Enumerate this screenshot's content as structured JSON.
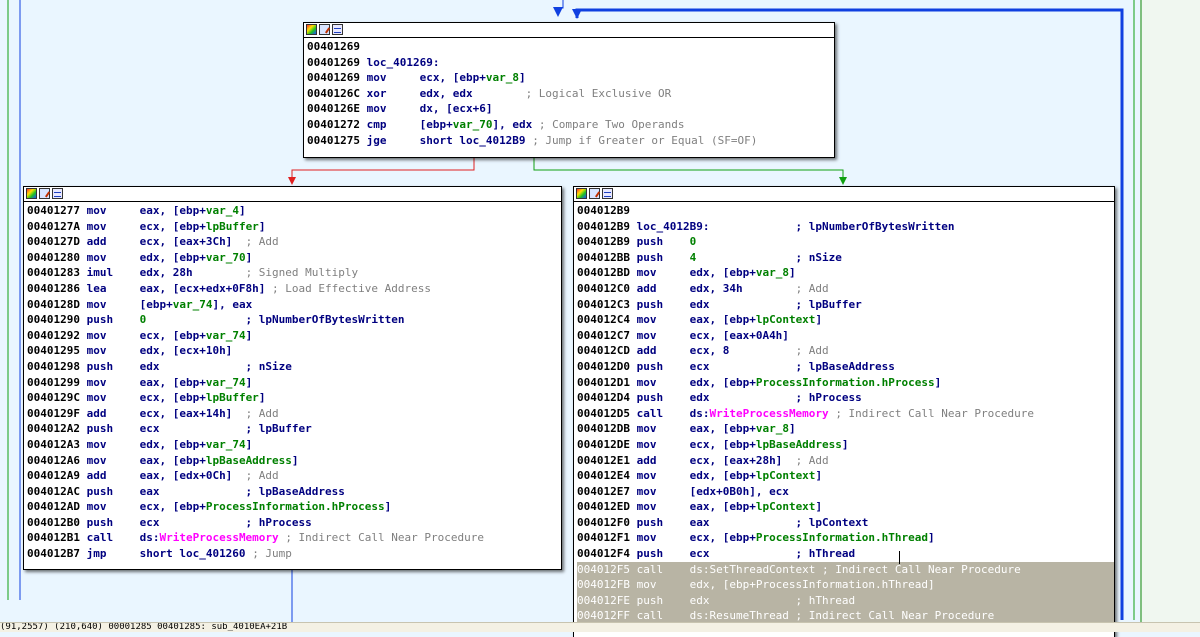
{
  "graph": {
    "nodes": [
      {
        "id": "top",
        "lines": [
          [
            [
              "00401269",
              "addr"
            ]
          ],
          [
            [
              "00401269 ",
              "addr"
            ],
            [
              "loc_401269:",
              "lbl"
            ]
          ],
          [
            [
              "00401269 ",
              "addr"
            ],
            [
              "mov     ",
              "mn"
            ],
            [
              "ecx, [ebp+",
              "op"
            ],
            [
              "var_8",
              "var"
            ],
            [
              "]",
              "op"
            ]
          ],
          [
            [
              "0040126C ",
              "addr"
            ],
            [
              "xor     ",
              "mn"
            ],
            [
              "edx, edx        ",
              "op"
            ],
            [
              "; Logical Exclusive OR",
              "cm"
            ]
          ],
          [
            [
              "0040126E ",
              "addr"
            ],
            [
              "mov     ",
              "mn"
            ],
            [
              "dx, [ecx+6]",
              "op"
            ]
          ],
          [
            [
              "00401272 ",
              "addr"
            ],
            [
              "cmp     ",
              "mn"
            ],
            [
              "[ebp+",
              "op"
            ],
            [
              "var_70",
              "var"
            ],
            [
              "], edx ",
              "op"
            ],
            [
              "; Compare Two Operands",
              "cm"
            ]
          ],
          [
            [
              "00401275 ",
              "addr"
            ],
            [
              "jge     ",
              "mn"
            ],
            [
              "short loc_4012B9 ",
              "op"
            ],
            [
              "; Jump if Greater or Equal (SF=OF)",
              "cm"
            ]
          ]
        ]
      },
      {
        "id": "left",
        "lines": [
          [
            [
              "00401277 ",
              "addr"
            ],
            [
              "mov     ",
              "mn"
            ],
            [
              "eax, [ebp+",
              "op"
            ],
            [
              "var_4",
              "var"
            ],
            [
              "]",
              "op"
            ]
          ],
          [
            [
              "0040127A ",
              "addr"
            ],
            [
              "mov     ",
              "mn"
            ],
            [
              "ecx, [ebp+",
              "op"
            ],
            [
              "lpBuffer",
              "var"
            ],
            [
              "]",
              "op"
            ]
          ],
          [
            [
              "0040127D ",
              "addr"
            ],
            [
              "add     ",
              "mn"
            ],
            [
              "ecx, [eax+3Ch]  ",
              "op"
            ],
            [
              "; Add",
              "cm"
            ]
          ],
          [
            [
              "00401280 ",
              "addr"
            ],
            [
              "mov     ",
              "mn"
            ],
            [
              "edx, [ebp+",
              "op"
            ],
            [
              "var_70",
              "var"
            ],
            [
              "]",
              "op"
            ]
          ],
          [
            [
              "00401283 ",
              "addr"
            ],
            [
              "imul    ",
              "mn"
            ],
            [
              "edx, 28h        ",
              "op"
            ],
            [
              "; Signed Multiply",
              "cm"
            ]
          ],
          [
            [
              "00401286 ",
              "addr"
            ],
            [
              "lea     ",
              "mn"
            ],
            [
              "eax, [ecx+edx+0F8h] ",
              "op"
            ],
            [
              "; Load Effective Address",
              "cm"
            ]
          ],
          [
            [
              "0040128D ",
              "addr"
            ],
            [
              "mov     ",
              "mn"
            ],
            [
              "[ebp+",
              "op"
            ],
            [
              "var_74",
              "var"
            ],
            [
              "], eax",
              "op"
            ]
          ],
          [
            [
              "00401290 ",
              "addr"
            ],
            [
              "push    ",
              "mn"
            ],
            [
              "0",
              "num"
            ],
            [
              "               ; lpNumberOfBytesWritten",
              "op"
            ]
          ],
          [
            [
              "00401292 ",
              "addr"
            ],
            [
              "mov     ",
              "mn"
            ],
            [
              "ecx, [ebp+",
              "op"
            ],
            [
              "var_74",
              "var"
            ],
            [
              "]",
              "op"
            ]
          ],
          [
            [
              "00401295 ",
              "addr"
            ],
            [
              "mov     ",
              "mn"
            ],
            [
              "edx, [ecx+10h]",
              "op"
            ]
          ],
          [
            [
              "00401298 ",
              "addr"
            ],
            [
              "push    ",
              "mn"
            ],
            [
              "edx             ; nSize",
              "op"
            ]
          ],
          [
            [
              "00401299 ",
              "addr"
            ],
            [
              "mov     ",
              "mn"
            ],
            [
              "eax, [ebp+",
              "op"
            ],
            [
              "var_74",
              "var"
            ],
            [
              "]",
              "op"
            ]
          ],
          [
            [
              "0040129C ",
              "addr"
            ],
            [
              "mov     ",
              "mn"
            ],
            [
              "ecx, [ebp+",
              "op"
            ],
            [
              "lpBuffer",
              "var"
            ],
            [
              "]",
              "op"
            ]
          ],
          [
            [
              "0040129F ",
              "addr"
            ],
            [
              "add     ",
              "mn"
            ],
            [
              "ecx, [eax+14h]  ",
              "op"
            ],
            [
              "; Add",
              "cm"
            ]
          ],
          [
            [
              "004012A2 ",
              "addr"
            ],
            [
              "push    ",
              "mn"
            ],
            [
              "ecx             ; lpBuffer",
              "op"
            ]
          ],
          [
            [
              "004012A3 ",
              "addr"
            ],
            [
              "mov     ",
              "mn"
            ],
            [
              "edx, [ebp+",
              "op"
            ],
            [
              "var_74",
              "var"
            ],
            [
              "]",
              "op"
            ]
          ],
          [
            [
              "004012A6 ",
              "addr"
            ],
            [
              "mov     ",
              "mn"
            ],
            [
              "eax, [ebp+",
              "op"
            ],
            [
              "lpBaseAddress",
              "var"
            ],
            [
              "]",
              "op"
            ]
          ],
          [
            [
              "004012A9 ",
              "addr"
            ],
            [
              "add     ",
              "mn"
            ],
            [
              "eax, [edx+0Ch]  ",
              "op"
            ],
            [
              "; Add",
              "cm"
            ]
          ],
          [
            [
              "004012AC ",
              "addr"
            ],
            [
              "push    ",
              "mn"
            ],
            [
              "eax             ; lpBaseAddress",
              "op"
            ]
          ],
          [
            [
              "004012AD ",
              "addr"
            ],
            [
              "mov     ",
              "mn"
            ],
            [
              "ecx, [ebp+",
              "op"
            ],
            [
              "ProcessInformation.hProcess",
              "var"
            ],
            [
              "]",
              "op"
            ]
          ],
          [
            [
              "004012B0 ",
              "addr"
            ],
            [
              "push    ",
              "mn"
            ],
            [
              "ecx             ; hProcess",
              "op"
            ]
          ],
          [
            [
              "004012B1 ",
              "addr"
            ],
            [
              "call    ",
              "mn"
            ],
            [
              "ds:",
              "op"
            ],
            [
              "WriteProcessMemory",
              "api"
            ],
            [
              " ",
              "op"
            ],
            [
              "; Indirect Call Near Procedure",
              "cm"
            ]
          ],
          [
            [
              "004012B7 ",
              "addr"
            ],
            [
              "jmp     ",
              "mn"
            ],
            [
              "short loc_401260 ",
              "op"
            ],
            [
              "; Jump",
              "cm"
            ]
          ]
        ]
      },
      {
        "id": "right",
        "lines": [
          [
            [
              "004012B9",
              "addr"
            ]
          ],
          [
            [
              "004012B9 ",
              "addr"
            ],
            [
              "loc_4012B9:",
              "lbl"
            ],
            [
              "             ; lpNumberOfBytesWritten",
              "op"
            ]
          ],
          [
            [
              "004012B9 ",
              "addr"
            ],
            [
              "push    ",
              "mn"
            ],
            [
              "0",
              "num"
            ]
          ],
          [
            [
              "004012BB ",
              "addr"
            ],
            [
              "push    ",
              "mn"
            ],
            [
              "4",
              "num"
            ],
            [
              "               ; nSize",
              "op"
            ]
          ],
          [
            [
              "004012BD ",
              "addr"
            ],
            [
              "mov     ",
              "mn"
            ],
            [
              "edx, [ebp+",
              "op"
            ],
            [
              "var_8",
              "var"
            ],
            [
              "]",
              "op"
            ]
          ],
          [
            [
              "004012C0 ",
              "addr"
            ],
            [
              "add     ",
              "mn"
            ],
            [
              "edx, 34h        ",
              "op"
            ],
            [
              "; Add",
              "cm"
            ]
          ],
          [
            [
              "004012C3 ",
              "addr"
            ],
            [
              "push    ",
              "mn"
            ],
            [
              "edx             ; lpBuffer",
              "op"
            ]
          ],
          [
            [
              "004012C4 ",
              "addr"
            ],
            [
              "mov     ",
              "mn"
            ],
            [
              "eax, [ebp+",
              "op"
            ],
            [
              "lpContext",
              "var"
            ],
            [
              "]",
              "op"
            ]
          ],
          [
            [
              "004012C7 ",
              "addr"
            ],
            [
              "mov     ",
              "mn"
            ],
            [
              "ecx, [eax+0A4h]",
              "op"
            ]
          ],
          [
            [
              "004012CD ",
              "addr"
            ],
            [
              "add     ",
              "mn"
            ],
            [
              "ecx, 8          ",
              "op"
            ],
            [
              "; Add",
              "cm"
            ]
          ],
          [
            [
              "004012D0 ",
              "addr"
            ],
            [
              "push    ",
              "mn"
            ],
            [
              "ecx             ; lpBaseAddress",
              "op"
            ]
          ],
          [
            [
              "004012D1 ",
              "addr"
            ],
            [
              "mov     ",
              "mn"
            ],
            [
              "edx, [ebp+",
              "op"
            ],
            [
              "ProcessInformation.hProcess",
              "var"
            ],
            [
              "]",
              "op"
            ]
          ],
          [
            [
              "004012D4 ",
              "addr"
            ],
            [
              "push    ",
              "mn"
            ],
            [
              "edx             ; hProcess",
              "op"
            ]
          ],
          [
            [
              "004012D5 ",
              "addr"
            ],
            [
              "call    ",
              "mn"
            ],
            [
              "ds:",
              "op"
            ],
            [
              "WriteProcessMemory",
              "api"
            ],
            [
              " ",
              "op"
            ],
            [
              "; Indirect Call Near Procedure",
              "cm"
            ]
          ],
          [
            [
              "004012DB ",
              "addr"
            ],
            [
              "mov     ",
              "mn"
            ],
            [
              "eax, [ebp+",
              "op"
            ],
            [
              "var_8",
              "var"
            ],
            [
              "]",
              "op"
            ]
          ],
          [
            [
              "004012DE ",
              "addr"
            ],
            [
              "mov     ",
              "mn"
            ],
            [
              "ecx, [ebp+",
              "op"
            ],
            [
              "lpBaseAddress",
              "var"
            ],
            [
              "]",
              "op"
            ]
          ],
          [
            [
              "004012E1 ",
              "addr"
            ],
            [
              "add     ",
              "mn"
            ],
            [
              "ecx, [eax+28h]  ",
              "op"
            ],
            [
              "; Add",
              "cm"
            ]
          ],
          [
            [
              "004012E4 ",
              "addr"
            ],
            [
              "mov     ",
              "mn"
            ],
            [
              "edx, [ebp+",
              "op"
            ],
            [
              "lpContext",
              "var"
            ],
            [
              "]",
              "op"
            ]
          ],
          [
            [
              "004012E7 ",
              "addr"
            ],
            [
              "mov     ",
              "mn"
            ],
            [
              "[edx+0B0h], ecx",
              "op"
            ]
          ],
          [
            [
              "004012ED ",
              "addr"
            ],
            [
              "mov     ",
              "mn"
            ],
            [
              "eax, [ebp+",
              "op"
            ],
            [
              "lpContext",
              "var"
            ],
            [
              "]",
              "op"
            ]
          ],
          [
            [
              "004012F0 ",
              "addr"
            ],
            [
              "push    ",
              "mn"
            ],
            [
              "eax             ; lpContext",
              "op"
            ]
          ],
          [
            [
              "004012F1 ",
              "addr"
            ],
            [
              "mov     ",
              "mn"
            ],
            [
              "ecx, [ebp+",
              "op"
            ],
            [
              "ProcessInformation.hThread",
              "var"
            ],
            [
              "]",
              "op"
            ]
          ],
          [
            [
              "004012F4 ",
              "addr"
            ],
            [
              "push    ",
              "mn"
            ],
            [
              "ecx             ; hThread",
              "op"
            ]
          ],
          [
            [
              "004012F5 ",
              "addr"
            ],
            [
              "call    ",
              "mn"
            ],
            [
              "ds:SetThreadContext ; Indirect Call Near Procedure",
              "op"
            ]
          ],
          [
            [
              "004012FB ",
              "addr"
            ],
            [
              "mov     ",
              "mn"
            ],
            [
              "edx, [ebp+ProcessInformation.hThread]",
              "op"
            ]
          ],
          [
            [
              "004012FE ",
              "addr"
            ],
            [
              "push    ",
              "mn"
            ],
            [
              "edx             ; hThread",
              "op"
            ]
          ],
          [
            [
              "004012FF ",
              "addr"
            ],
            [
              "call    ",
              "mn"
            ],
            [
              "ds:ResumeThread ; Indirect Call Near Procedure",
              "op"
            ]
          ]
        ]
      }
    ],
    "selected_lines": {
      "right": [
        23,
        24,
        25,
        26
      ]
    }
  },
  "statusbar": {
    "text": "(91,2557) (210,640) 00001285 00401285: sub_4010EA+21B"
  },
  "colors": {
    "canvas": "#eaf6ff",
    "edge_false": "#e02020",
    "edge_true": "#10a010",
    "edge_jump": "#1040e0",
    "panel_border": "#7fbf7f"
  }
}
